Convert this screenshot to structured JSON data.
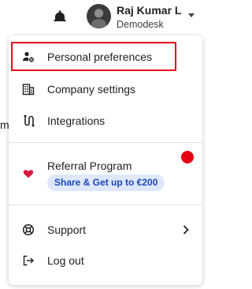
{
  "header": {
    "user_name": "Raj Kumar L",
    "organization": "Demodesk",
    "icons": [
      "bell-icon",
      "avatar",
      "chevron-down-icon"
    ]
  },
  "background": {
    "partial_text": "m"
  },
  "menu": {
    "personal_preferences": "Personal preferences",
    "company_settings": "Company settings",
    "integrations": "Integrations",
    "referral_program": "Referral Program",
    "referral_badge": "Share & Get up to €200",
    "support": "Support",
    "log_out": "Log out",
    "icons": {
      "personal_preferences": "user-settings-icon",
      "company_settings": "building-icon",
      "integrations": "integrations-icon",
      "referral_program": "heart-icon",
      "support": "lifebuoy-icon",
      "log_out": "logout-icon",
      "support_chevron": "chevron-right-icon"
    },
    "highlighted_item": "personal_preferences"
  },
  "colors": {
    "highlight_border": "#e0101c",
    "notification_dot": "#e60012",
    "heart": "#d81b3c",
    "badge_background": "#dfe8fb",
    "badge_text": "#1a47b8"
  }
}
